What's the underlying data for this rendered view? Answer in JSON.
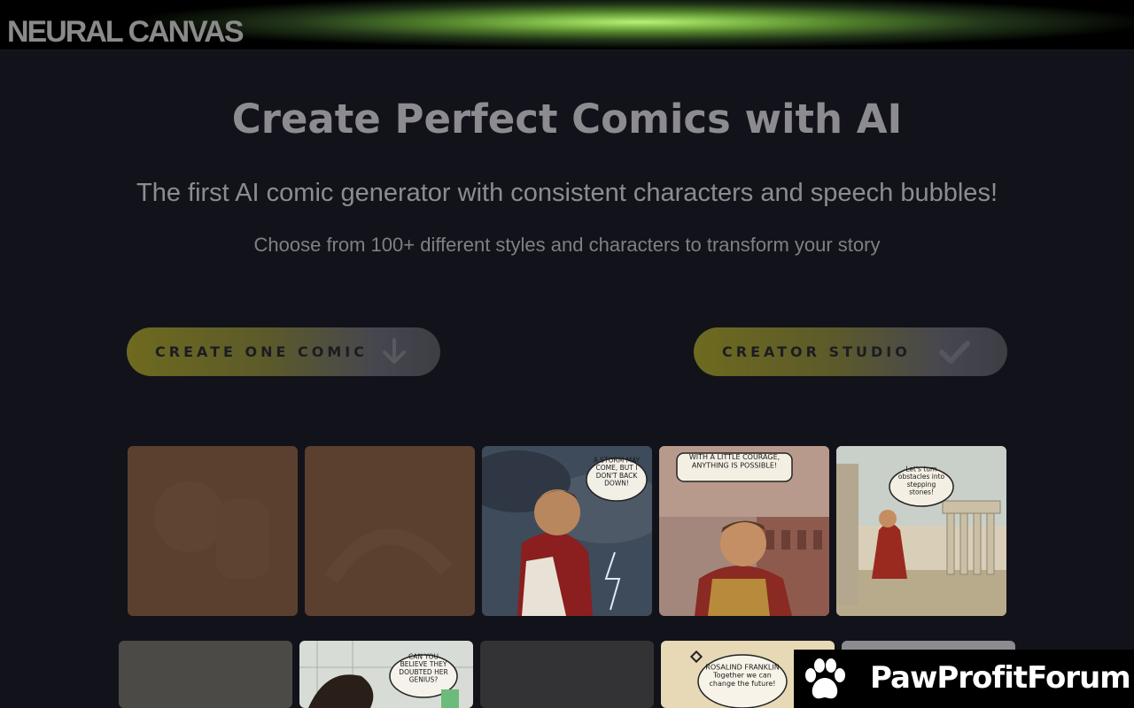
{
  "header": {
    "logo_text": "NEURAL CANVAS",
    "glow_color": "#a5e066"
  },
  "hero": {
    "title": "Create Perfect Comics with AI",
    "subtitle": "The first AI comic generator with consistent characters and speech bubbles!",
    "tagline": "Choose from 100+ different styles and characters to transform your story"
  },
  "actions": {
    "create_one_label": "CREATE ONE COMIC",
    "create_one_icon": "arrow-down-icon",
    "studio_label": "CREATOR STUDIO",
    "studio_icon": "check-icon"
  },
  "gallery": {
    "tiles": [
      {
        "bubble": ""
      },
      {
        "bubble": ""
      },
      {
        "bubble": "A STORM MAY COME, BUT I DON'T BACK DOWN!"
      },
      {
        "bubble": "WITH A LITTLE COURAGE, ANYTHING IS POSSIBLE!"
      },
      {
        "bubble": "Let's turn obstacles into stepping stones!"
      },
      {
        "bubble": ""
      },
      {
        "bubble": "CAN YOU BELIEVE THEY DOUBTED HER GENIUS?"
      },
      {
        "bubble": ""
      },
      {
        "bubble_title": "ROSALIND FRANKLIN",
        "bubble": "Together we can change the future!"
      },
      {
        "bubble": ""
      }
    ]
  },
  "badge": {
    "text": "PawProfitForum",
    "icon": "paw-icon"
  },
  "colors": {
    "background": "#12121a",
    "button_gradient_start": "#6e6a1f",
    "button_gradient_end": "#3d3d44"
  }
}
